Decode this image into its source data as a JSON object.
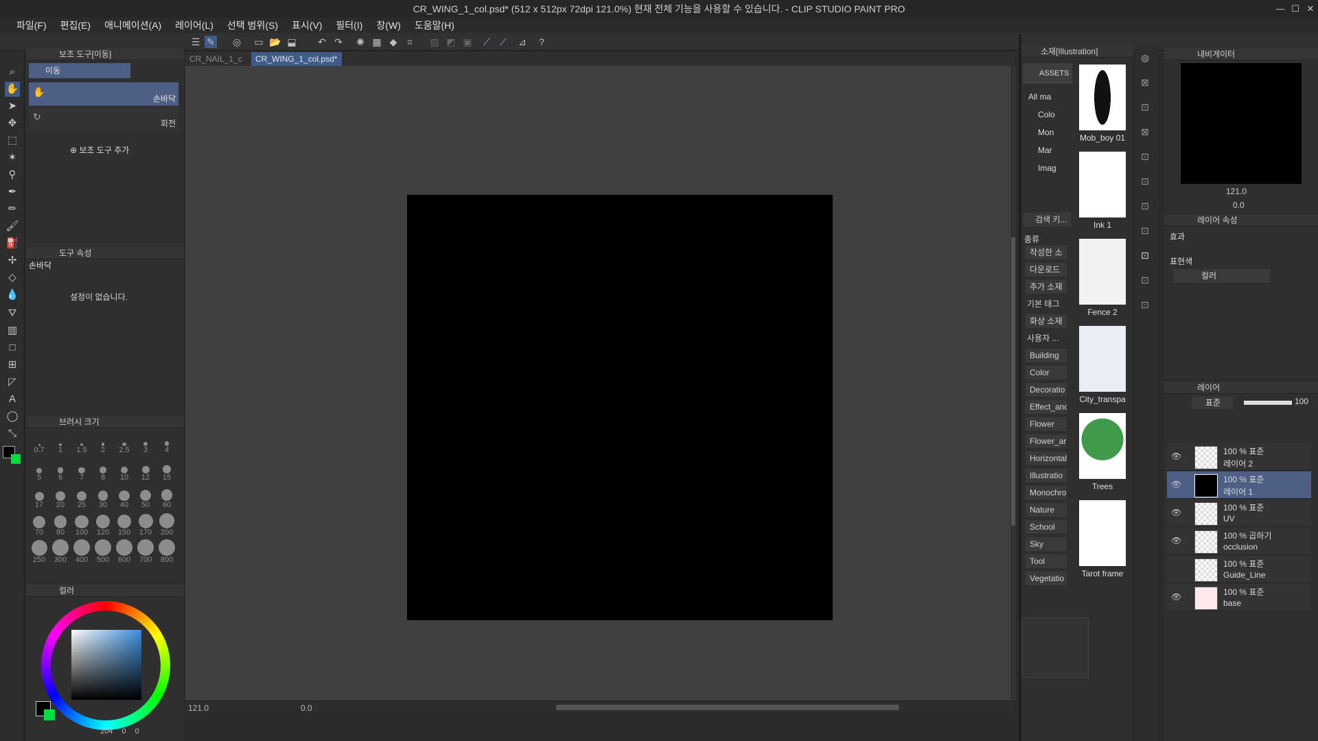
{
  "window": {
    "title": "CR_WING_1_col.psd* (512 x 512px 72dpi 121.0%)  현재 전체 기능을 사용할 수 있습니다. - CLIP STUDIO PAINT PRO",
    "controls": [
      "—",
      "☐",
      "✕"
    ]
  },
  "menu": [
    "파일(F)",
    "편집(E)",
    "애니메이션(A)",
    "레이어(L)",
    "선택 범위(S)",
    "표시(V)",
    "필터(I)",
    "창(W)",
    "도움말(H)"
  ],
  "tabs": [
    {
      "label": "CR_NAIL_1_c",
      "close": "✕",
      "active": false
    },
    {
      "label": "CR_WING_1_col.psd*",
      "close": "•",
      "active": true
    }
  ],
  "subtool_panel": {
    "header": "보조 도구[이동]",
    "group_tab": "이동",
    "items": [
      {
        "label": "손바닥",
        "selected": true
      },
      {
        "label": "회전",
        "selected": false
      }
    ],
    "add_label": "보조 도구 추가"
  },
  "tool_property": {
    "header": "도구 속성",
    "tool_name": "손바닥",
    "empty_message": "설정이 없습니다."
  },
  "brush_size": {
    "header": "브러시 크기",
    "sizes": [
      "0.7",
      "1",
      "1.5",
      "2",
      "2.5",
      "3",
      "4",
      "5",
      "6",
      "7",
      "8",
      "10",
      "12",
      "15",
      "17",
      "20",
      "25",
      "30",
      "40",
      "50",
      "60",
      "70",
      "80",
      "100",
      "120",
      "150",
      "170",
      "200",
      "250",
      "300",
      "400",
      "500",
      "600",
      "700",
      "800"
    ]
  },
  "color_panel": {
    "header": "컬러",
    "main_color": "#000000",
    "sub_color": "#00e040",
    "readout": [
      "204",
      "0",
      "0"
    ]
  },
  "material_panel": {
    "header": "소재[Illustration]",
    "assets_label": "ASSETS",
    "tree": [
      "All ma",
      "Colo",
      "Mon",
      "Mar",
      "Imag"
    ],
    "search_label": "검색 키...",
    "kind_label": "종류",
    "categories": [
      "작성한 소",
      "다운로드",
      "추가 소재",
      "기본 태그",
      "화상 소재",
      "사용자 ...",
      "Building",
      "Color",
      "Decoratio",
      "Effect_and",
      "Flower",
      "Flower_ar",
      "Horizontal",
      "Illustratio",
      "Monochro",
      "Nature",
      "School",
      "Sky",
      "Tool",
      "Vegetatio"
    ],
    "thumbnails": [
      "Mob_boy 01",
      "Ink 1",
      "Fence 2",
      "City_transpa",
      "Trees",
      "Tarot frame"
    ]
  },
  "navigator": {
    "header": "내비게이터",
    "zoom": "121.0",
    "rotation": "0.0"
  },
  "layer_property": {
    "header": "레이어 속성",
    "effect_label": "효과",
    "expression_label": "표현색",
    "expression_value": "컬러"
  },
  "layers": {
    "header": "레이어",
    "blend_mode": "표준",
    "opacity": "100",
    "opacity_fraction": 1.0,
    "items": [
      {
        "mode": "100 % 표준",
        "name": "레이어 2",
        "visible": true,
        "selected": false,
        "thumb": "checker"
      },
      {
        "mode": "100 % 표준",
        "name": "레이어 1",
        "visible": true,
        "selected": true,
        "thumb": "black"
      },
      {
        "mode": "100 % 표준",
        "name": "UV",
        "visible": true,
        "selected": false,
        "thumb": "checker"
      },
      {
        "mode": "100 % 곱하기",
        "name": "occlusion",
        "visible": true,
        "selected": false,
        "thumb": "checker"
      },
      {
        "mode": "100 % 표준",
        "name": "Guide_Line",
        "visible": false,
        "selected": false,
        "thumb": "checker"
      },
      {
        "mode": "100 % 표준",
        "name": "base",
        "visible": true,
        "selected": false,
        "thumb": "pink"
      }
    ]
  },
  "statusbar": {
    "zoom": "121.0",
    "angle": "0.0"
  },
  "colors": {
    "accent": "#4d5f84",
    "canvas": "#000000",
    "workspace": "#404040"
  }
}
